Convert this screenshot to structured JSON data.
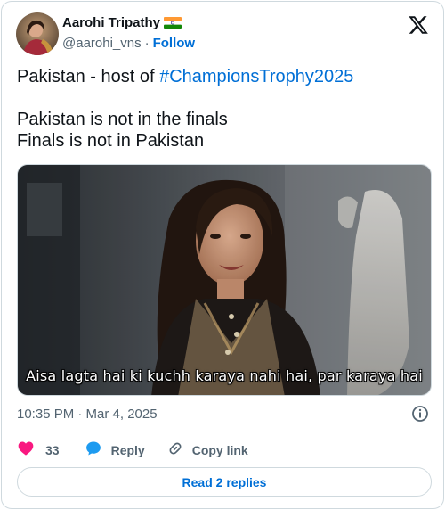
{
  "author": {
    "name": "Aarohi Tripathy",
    "handle": "@aarohi_vns",
    "follow_label": "Follow",
    "flag_icon": "india-flag-icon"
  },
  "brand": {
    "logo": "x-logo-icon"
  },
  "tweet": {
    "line1_prefix": "Pakistan - host of ",
    "hashtag": "#ChampionsTrophy2025",
    "line2": "Pakistan is not in the finals",
    "line3": "Finals is not in Pakistan"
  },
  "media": {
    "caption": "Aisa lagta hai ki kuchh karaya nahi hai, par karaya hai"
  },
  "meta": {
    "timestamp": "10:35 PM · Mar 4, 2025",
    "info_icon": "info-icon"
  },
  "actions": {
    "like_count": "33",
    "reply_label": "Reply",
    "copy_label": "Copy link"
  },
  "footer": {
    "read_replies_label": "Read 2 replies"
  },
  "colors": {
    "link": "#006fd6",
    "muted": "#536471",
    "like": "#f91880",
    "reply": "#1d9bf0",
    "border": "#cfd9de"
  }
}
